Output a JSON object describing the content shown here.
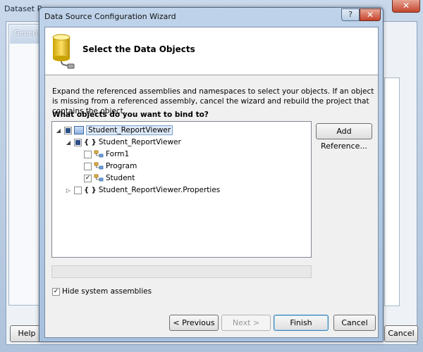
{
  "background_window": {
    "title": "Dataset Prop",
    "tab_general": "General",
    "help_button": "Help",
    "cancel_button": "Cancel",
    "close_glyph": "✕"
  },
  "dialog": {
    "title": "Data Source Configuration Wizard",
    "help_glyph": "?",
    "close_glyph": "✕",
    "header_title": "Select the Data Objects",
    "description": "Expand the referenced assemblies and namespaces to select your objects. If an object is missing from a referenced assembly, cancel the wizard and rebuild the project that contains the object.",
    "question": "What objects do you want to bind to?",
    "add_reference_button": "Add Reference...",
    "tree": {
      "root": {
        "label": "Student_ReportViewer",
        "checked": "partial",
        "expanded": true,
        "icon": "project-icon"
      },
      "namespace": {
        "label": "Student_ReportViewer",
        "checked": "partial",
        "expanded": true,
        "icon": "namespace-icon",
        "glyph": "{ }"
      },
      "classes": [
        {
          "label": "Form1",
          "checked": false,
          "icon": "class-icon"
        },
        {
          "label": "Program",
          "checked": false,
          "icon": "class-icon"
        },
        {
          "label": "Student",
          "checked": true,
          "icon": "class-icon"
        }
      ],
      "namespace2": {
        "label": "Student_ReportViewer.Properties",
        "checked": false,
        "expanded": false,
        "icon": "namespace-icon",
        "glyph": "{ }"
      },
      "expanded_glyph": "◢",
      "collapsed_glyph": "▷",
      "check_glyph": "✓"
    },
    "hide_system_assemblies": {
      "label": "Hide system assemblies",
      "checked": true
    },
    "buttons": {
      "previous": "< Previous",
      "next": "Next >",
      "finish": "Finish",
      "cancel": "Cancel"
    }
  },
  "colors": {
    "selection_fill": "#dde9f7",
    "selection_border": "#7da2ce",
    "checkbox_fill": "#2a4f86"
  }
}
